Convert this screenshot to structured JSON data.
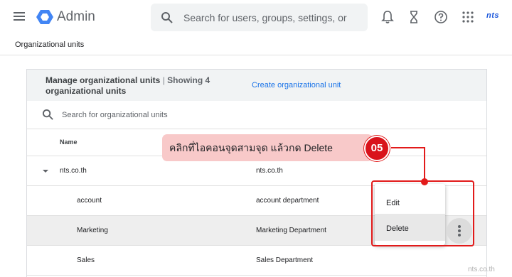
{
  "topbar": {
    "app_title": "Admin",
    "search_placeholder": "Search for users, groups, settings, or",
    "brand": "nts"
  },
  "breadcrumb": "Organizational units",
  "card": {
    "title": "Manage organizational units",
    "separator": "|",
    "showing": "Showing 4",
    "title_line2": "organizational units",
    "create_link": "Create organizational unit",
    "search_placeholder": "Search for organizational units",
    "column_name": "Name",
    "rows": [
      {
        "name": "nts.co.th",
        "description": "nts.co.th"
      },
      {
        "name": "account",
        "description": "account department"
      },
      {
        "name": "Marketing",
        "description": "Marketing Department"
      },
      {
        "name": "Sales",
        "description": "Sales Department"
      }
    ]
  },
  "context_menu": {
    "items": [
      {
        "label": "Edit"
      },
      {
        "label": "Delete"
      }
    ]
  },
  "annotation": {
    "text": "คลิกที่ไอคอนจุดสามจุด แล้วกด Delete",
    "step": "05",
    "color": "#e21a1a"
  },
  "watermark": "nts.co.th"
}
